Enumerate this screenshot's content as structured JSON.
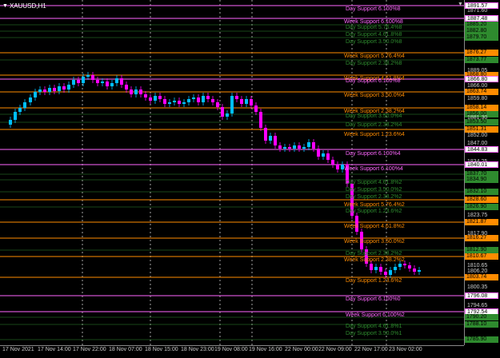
{
  "symbol_title": "XAUUSD,H1",
  "icons": {
    "title": "triangle-down-icon",
    "collapse": "chevron-down-icon"
  },
  "colors": {
    "background": "#000000",
    "bull": "#00bfff",
    "bear": "#ff00ff",
    "level_pink": "#ff66ff",
    "level_orange": "#ff8c00",
    "level_green": "#2e8b2e"
  },
  "price_axis_labels": [
    "1847.00",
    "1834.25",
    "1823.75",
    "1817.90",
    "1810.65",
    "1806.20",
    "1800.35",
    "1794.65",
    "1889.05",
    "1881.30",
    "1871.60",
    "1866.00",
    "1859.80",
    "1852.00"
  ],
  "price_boxes": [
    {
      "text": "1891.57",
      "color": "pink"
    },
    {
      "text": "1887.48",
      "color": "pink"
    },
    {
      "text": "1885.20",
      "color": "green"
    },
    {
      "text": "1882.80",
      "color": "green"
    },
    {
      "text": "1879.70",
      "color": "green"
    },
    {
      "text": "1876.27",
      "color": "orange"
    },
    {
      "text": "1873.77",
      "color": "green"
    },
    {
      "text": "1868.80",
      "color": "orange"
    },
    {
      "text": "1866.80",
      "color": "pink"
    },
    {
      "text": "1863.74",
      "color": "orange"
    },
    {
      "text": "1858.14",
      "color": "orange"
    },
    {
      "text": "1856.00",
      "color": "green"
    },
    {
      "text": "1853.50",
      "color": "green"
    },
    {
      "text": "1851.31",
      "color": "orange"
    },
    {
      "text": "1844.83",
      "color": "pink"
    },
    {
      "text": "1840.01",
      "color": "pink"
    },
    {
      "text": "1837.70",
      "color": "green"
    },
    {
      "text": "1834.90",
      "color": "green"
    },
    {
      "text": "1832.10",
      "color": "green"
    },
    {
      "text": "1828.60",
      "color": "orange"
    },
    {
      "text": "1826.90",
      "color": "green"
    },
    {
      "text": "1821.87",
      "color": "orange"
    },
    {
      "text": "1816.27",
      "color": "orange"
    },
    {
      "text": "1812.90",
      "color": "green"
    },
    {
      "text": "1810.67",
      "color": "orange"
    },
    {
      "text": "1803.74",
      "color": "orange"
    },
    {
      "text": "1796.08",
      "color": "pink"
    },
    {
      "text": "1792.54",
      "color": "pink"
    },
    {
      "text": "1790.20",
      "color": "green"
    },
    {
      "text": "1788.10",
      "color": "green"
    },
    {
      "text": "1785.90",
      "color": "green"
    }
  ],
  "time_labels": [
    "17 Nov 2021",
    "17 Nov 14:00",
    "17 Nov 22:00",
    "18 Nov 07:00",
    "18 Nov 15:00",
    "18 Nov 23:00",
    "19 Nov 08:00",
    "19 Nov 16:00",
    "22 Nov 00:00",
    "22 Nov 09:00",
    "22 Nov 17:00",
    "23 Nov 02:00"
  ],
  "levels": [
    {
      "text": "Day Support 6.100%8",
      "color": "pink"
    },
    {
      "text": "Week Support 6.100%8",
      "color": "pink"
    },
    {
      "text": "Day Support 5.76.4%8",
      "color": "green"
    },
    {
      "text": "Day Support 4.61.8%8",
      "color": "green"
    },
    {
      "text": "Day Support 3.50.0%8",
      "color": "green"
    },
    {
      "text": "Week Support 5.76.4%4",
      "color": "orange"
    },
    {
      "text": "Day Support 2.38.2%8",
      "color": "green"
    },
    {
      "text": "Week Support 4.61.8%4",
      "color": "orange"
    },
    {
      "text": "Day Support 6.100%8",
      "color": "pink"
    },
    {
      "text": "Week Support 3.50.0%4",
      "color": "orange"
    },
    {
      "text": "Week Support 2.38.2%4",
      "color": "orange"
    },
    {
      "text": "Day Support 3.50.0%4",
      "color": "green"
    },
    {
      "text": "Day Support 2.38.2%4",
      "color": "green"
    },
    {
      "text": "Week Support 1.23.6%4",
      "color": "orange"
    },
    {
      "text": "Day Support 6.100%4",
      "color": "pink"
    },
    {
      "text": "Week Support 6.100%4",
      "color": "pink"
    },
    {
      "text": "Day Support 4.61.8%2",
      "color": "green"
    },
    {
      "text": "Day Support 3.50.0%2",
      "color": "green"
    },
    {
      "text": "Day Support 2.38.2%2",
      "color": "green"
    },
    {
      "text": "Week Support 5.76.4%2",
      "color": "orange"
    },
    {
      "text": "Day Support 1.23.6%2",
      "color": "green"
    },
    {
      "text": "Week Support 4.61.8%2",
      "color": "orange"
    },
    {
      "text": "Week Support 3.50.0%2",
      "color": "orange"
    },
    {
      "text": "Day Support 2.38.2%2",
      "color": "green"
    },
    {
      "text": "Week Support 2.38.2%2",
      "color": "orange"
    },
    {
      "text": "Day Support 1.23.6%2",
      "color": "orange"
    },
    {
      "text": "Day Support 6.100%0",
      "color": "pink"
    },
    {
      "text": "Week Support 6.100%2",
      "color": "pink"
    },
    {
      "text": "Day Support 4.61.8%1",
      "color": "green"
    },
    {
      "text": "Day Support 3.50.0%1",
      "color": "green"
    }
  ]
}
